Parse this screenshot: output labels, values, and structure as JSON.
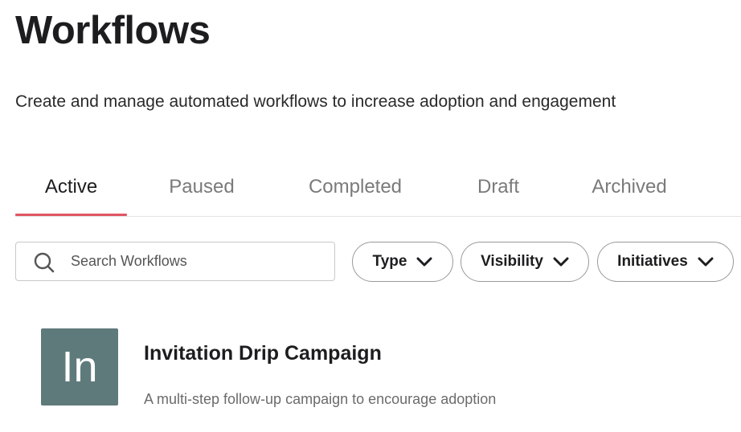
{
  "page": {
    "title": "Workflows",
    "subtitle": "Create and manage automated workflows to increase adoption and engagement"
  },
  "tabs": [
    {
      "label": "Active",
      "active": true
    },
    {
      "label": "Paused",
      "active": false
    },
    {
      "label": "Completed",
      "active": false
    },
    {
      "label": "Draft",
      "active": false
    },
    {
      "label": "Archived",
      "active": false
    }
  ],
  "search": {
    "placeholder": "Search Workflows",
    "value": "",
    "icon": "search-icon"
  },
  "filters": [
    {
      "label": "Type",
      "icon": "chevron-down-icon"
    },
    {
      "label": "Visibility",
      "icon": "chevron-down-icon"
    },
    {
      "label": "Initiatives",
      "icon": "chevron-down-icon"
    }
  ],
  "workflows": [
    {
      "avatar_text": "In",
      "avatar_color": "#5f7a7a",
      "title": "Invitation Drip Campaign",
      "description": "A multi-step follow-up campaign to encourage adoption"
    }
  ],
  "colors": {
    "active_tab_underline": "#e05563"
  }
}
